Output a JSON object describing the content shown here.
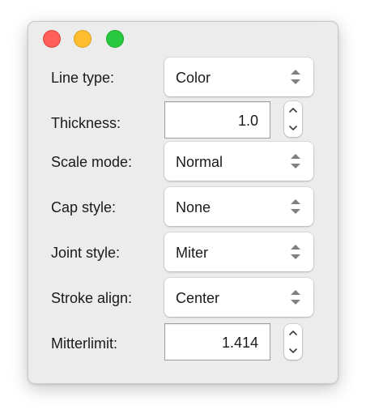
{
  "window": {
    "controls": {
      "close": "close-icon",
      "minimize": "minimize-icon",
      "zoom": "zoom-icon"
    }
  },
  "form": {
    "line_type": {
      "label": "Line type:",
      "value": "Color"
    },
    "thickness": {
      "label": "Thickness:",
      "value": "1.0"
    },
    "scale_mode": {
      "label": "Scale mode:",
      "value": "Normal"
    },
    "cap_style": {
      "label": "Cap style:",
      "value": "None"
    },
    "joint_style": {
      "label": "Joint style:",
      "value": "Miter"
    },
    "stroke_align": {
      "label": "Stroke align:",
      "value": "Center"
    },
    "mitterlimit": {
      "label": "Mitterlimit:",
      "value": "1.414"
    }
  },
  "colors": {
    "close": "#fe5f57",
    "minimize": "#febc2e",
    "zoom": "#28c840",
    "window_bg": "#ececec"
  }
}
